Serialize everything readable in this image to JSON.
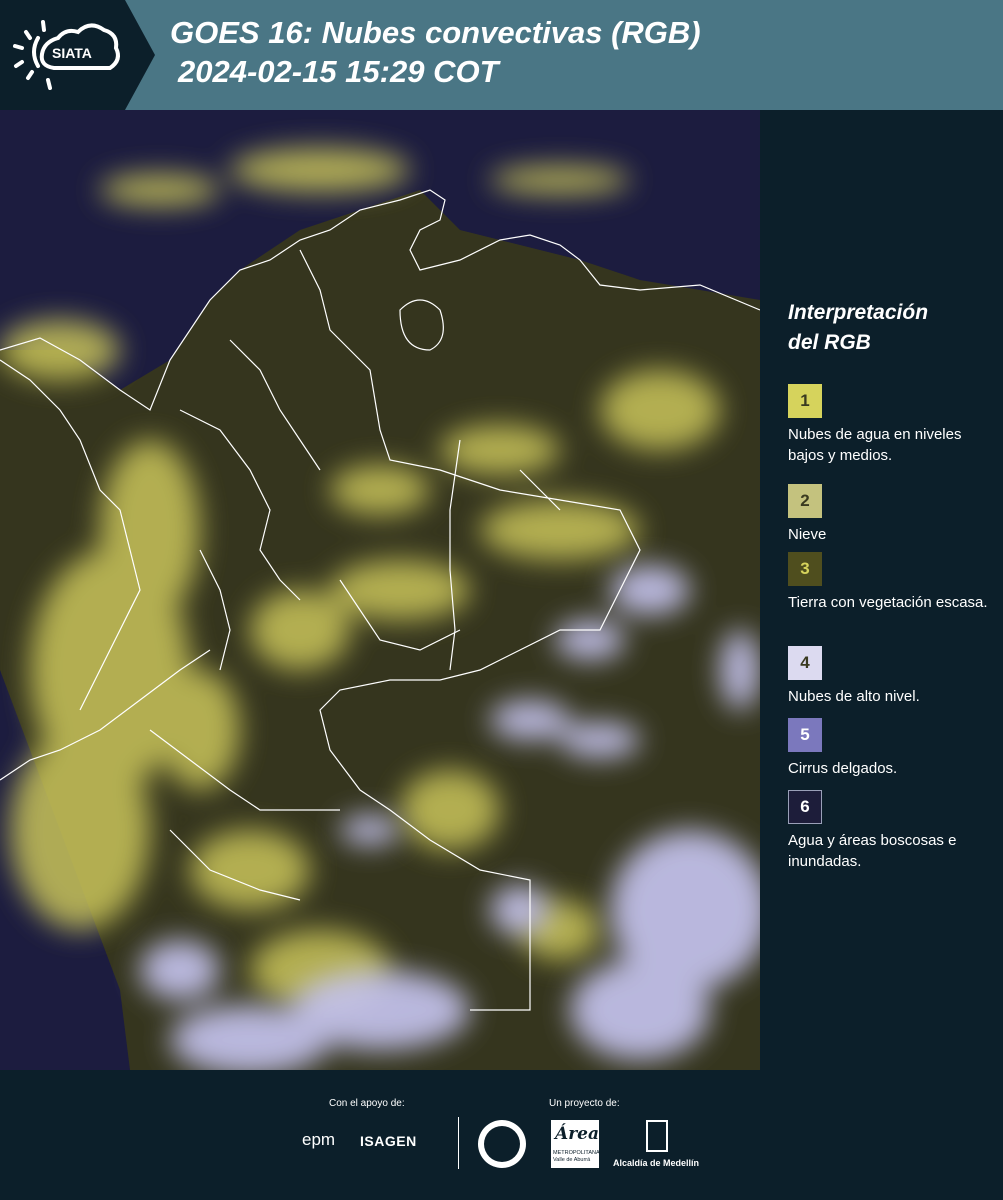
{
  "header": {
    "logo_text": "SIATA",
    "title_line1": "GOES 16: Nubes convectivas (RGB)",
    "title_line2": "2024-02-15 15:29 COT"
  },
  "legend": {
    "title_line1": "Interpretación",
    "title_line2": "del RGB",
    "items": [
      {
        "number": "1",
        "label": "Nubes de agua en niveles bajos y medios.",
        "color": "#d6d35c"
      },
      {
        "number": "2",
        "label": "Nieve",
        "color": "#c4c27e"
      },
      {
        "number": "3",
        "label": "Tierra con vegetación escasa.",
        "color": "#4f4e1e"
      },
      {
        "number": "4",
        "label": "Nubes de alto nivel.",
        "color": "#dcdaf0"
      },
      {
        "number": "5",
        "label": "Cirrus delgados.",
        "color": "#7b78bd"
      },
      {
        "number": "6",
        "label": "Agua y áreas boscosas e inundadas.",
        "color": "#1d1d3a"
      }
    ]
  },
  "footer": {
    "support_label": "Con el apoyo de:",
    "project_label": "Un proyecto de:",
    "sponsor1": "epm",
    "sponsor2": "ISAGEN",
    "partner1_title": "Área",
    "partner1_sub": "METROPOLITANA Valle de Aburrá",
    "partner2": "Alcaldía de Medellín"
  },
  "colors": {
    "header_bg": "#4a7685",
    "page_bg": "#0c1f2a",
    "ocean": "#1c1c3f",
    "low_clouds": "#c9c45a",
    "high_clouds": "#c8c6f2",
    "borders": "#ffffff"
  }
}
